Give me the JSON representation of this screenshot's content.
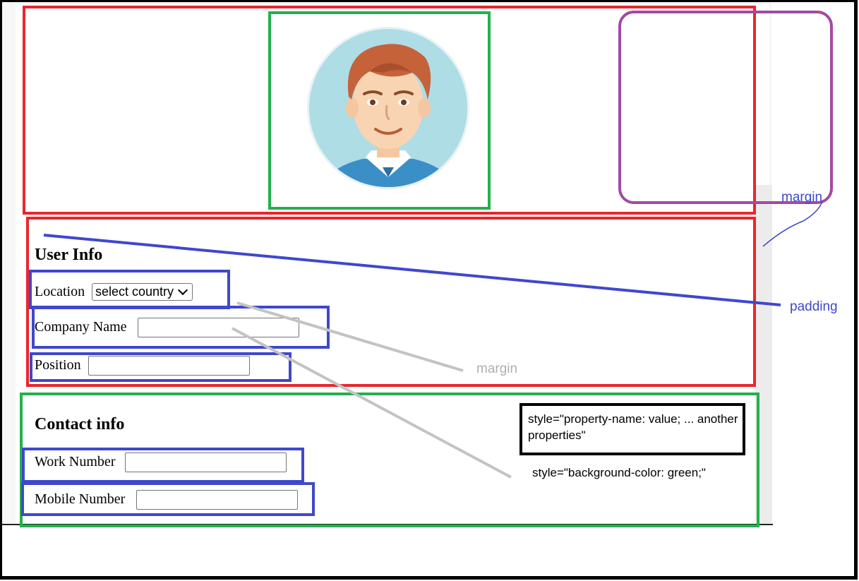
{
  "user_info": {
    "heading": "User Info",
    "location_label": "Location",
    "location_select_value": "select country",
    "company_label": "Company Name",
    "company_value": "",
    "position_label": "Position",
    "position_value": ""
  },
  "contact_info": {
    "heading": "Contact info",
    "work_label": "Work Number",
    "work_value": "",
    "mobile_label": "Mobile Number",
    "mobile_value": ""
  },
  "annotations": {
    "margin_top": "margin",
    "padding": "padding",
    "margin_gray": "margin",
    "style_syntax": "style=\"property-name: value; ... another properties\"",
    "style_example": "style=\"background-color: green;\""
  },
  "avatar": {
    "icon": "user-avatar-icon"
  },
  "colors": {
    "red_box": "#e8262d",
    "green_box": "#22b14c",
    "blue_box": "#3f48cc",
    "purple_box": "#a349a4",
    "annotation_blue": "#3f48cc",
    "annotation_gray": "#b0b0b0"
  }
}
